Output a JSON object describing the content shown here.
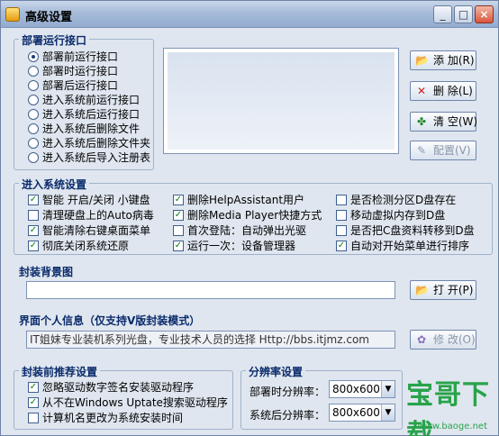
{
  "window": {
    "title": "高级设置"
  },
  "title_buttons": [
    "_",
    "□",
    "×"
  ],
  "deploy": {
    "group_label": "部署运行接口",
    "options": [
      {
        "label": "部署前运行接口",
        "selected": true
      },
      {
        "label": "部署时运行接口",
        "selected": false
      },
      {
        "label": "部署后运行接口",
        "selected": false
      },
      {
        "label": "进入系统前运行接口",
        "selected": false
      },
      {
        "label": "进入系统后运行接口",
        "selected": false
      },
      {
        "label": "进入系统后删除文件",
        "selected": false
      },
      {
        "label": "进入系统后删除文件夹",
        "selected": false
      },
      {
        "label": "进入系统后导入注册表",
        "selected": false
      }
    ],
    "buttons": {
      "add": "添 加(R)",
      "delete": "删 除(L)",
      "clear": "清 空(W)",
      "config": "配置(V)"
    }
  },
  "system": {
    "group_label": "进入系统设置",
    "checks": [
      {
        "label": "智能 开启/关闭 小键盘",
        "checked": true
      },
      {
        "label": "删除HelpAssistant用户",
        "checked": true
      },
      {
        "label": "是否检测分区D盘存在",
        "checked": false
      },
      {
        "label": "清理硬盘上的Auto病毒",
        "checked": false
      },
      {
        "label": "删除Media Player快捷方式",
        "checked": true
      },
      {
        "label": "移动虚拟内存到D盘",
        "checked": false
      },
      {
        "label": "智能清除右键桌面菜单",
        "checked": true
      },
      {
        "label": "首次登陆：自动弹出光驱",
        "checked": false
      },
      {
        "label": "是否把C盘资料转移到D盘",
        "checked": false
      },
      {
        "label": "彻底关闭系统还原",
        "checked": true
      },
      {
        "label": "运行一次：设备管理器",
        "checked": true
      },
      {
        "label": "自动对开始菜单进行排序",
        "checked": true
      }
    ]
  },
  "background": {
    "label": "封装背景图",
    "value": "",
    "open_button": "打 开(P)"
  },
  "personal": {
    "label": "界面个人信息（仅支持V版封装模式）",
    "value": "IT姐妹专业装机系列光盘，专业技术人员的选择  Http://bbs.itjmz.com",
    "modify_button": "修 改(O)"
  },
  "recommend": {
    "label": "封装前推荐设置",
    "checks": [
      {
        "label": "忽略驱动数字签名安装驱动程序",
        "checked": true
      },
      {
        "label": "从不在Windows  Uptate搜索驱动程序",
        "checked": true
      },
      {
        "label": "计算机名更改为系统安装时间",
        "checked": false
      }
    ]
  },
  "resolution": {
    "label": "分辨率设置",
    "deploy_label": "部署时分辨率：",
    "deploy_value": "800x600",
    "system_label": "系统后分辨率：",
    "system_value": "800x600"
  },
  "watermark": {
    "text": "宝哥下载",
    "url": "www.baoge.net"
  },
  "colors": {
    "accent": "#0a2b6b",
    "check": "#0b7a1c",
    "watermark": "#28a34a"
  },
  "icons": [
    "app-icon",
    "add-icon",
    "delete-icon",
    "clear-icon",
    "config-icon",
    "open-icon",
    "modify-icon",
    "combo-arrow-icon"
  ]
}
